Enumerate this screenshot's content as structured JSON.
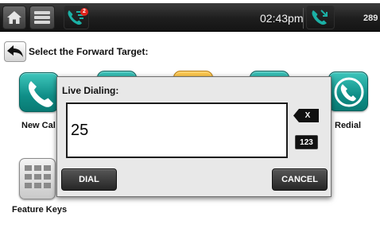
{
  "status_bar": {
    "time": "02:43pm",
    "extension": "289",
    "notification_count": "2"
  },
  "page": {
    "title": "Select the Forward Target:"
  },
  "tiles": {
    "new_call_label": "New Cal",
    "redial_label": "Redial",
    "feature_keys_label": "Feature Keys"
  },
  "dialog": {
    "title": "Live Dialing:",
    "input_value": "25",
    "backspace_label": "X",
    "mode_label": "123",
    "dial_label": "DIAL",
    "cancel_label": "CANCEL"
  },
  "colors": {
    "accent_teal": "#12968f",
    "accent_orange": "#f0a012",
    "status_bar": "#1e1e1e",
    "notification_badge": "#e0231c"
  }
}
